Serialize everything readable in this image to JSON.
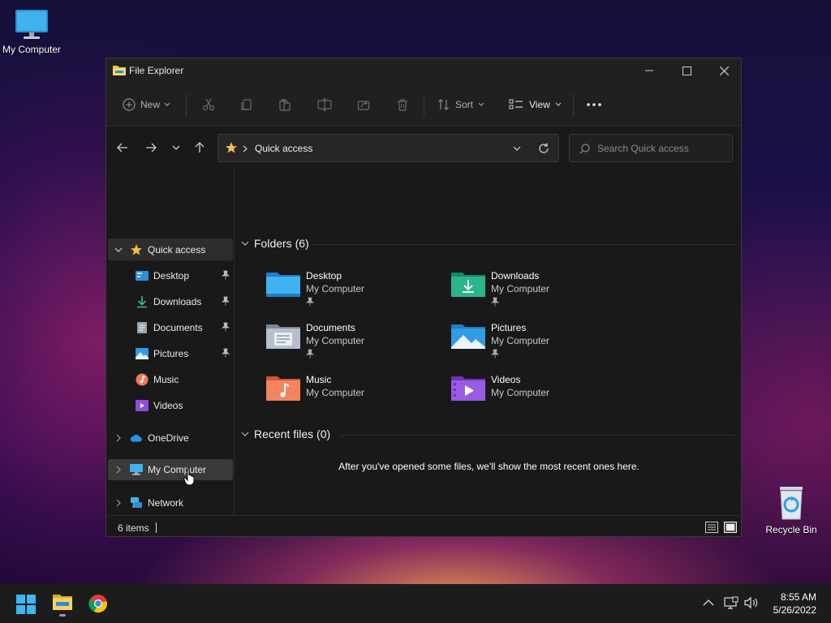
{
  "desktop": {
    "my_computer_label": "My Computer",
    "recycle_bin_label": "Recycle Bin"
  },
  "window": {
    "title": "File Explorer"
  },
  "toolbar": {
    "new_label": "New",
    "sort_label": "Sort",
    "view_label": "View"
  },
  "address": {
    "path": "Quick access",
    "search_placeholder": "Search Quick access"
  },
  "sidebar": {
    "quick_access": "Quick access",
    "pinned": [
      {
        "label": "Desktop"
      },
      {
        "label": "Downloads"
      },
      {
        "label": "Documents"
      },
      {
        "label": "Pictures"
      },
      {
        "label": "Music"
      },
      {
        "label": "Videos"
      }
    ],
    "onedrive": "OneDrive",
    "my_computer": "My Computer",
    "network": "Network"
  },
  "content": {
    "folders_header": "Folders (6)",
    "folders": [
      {
        "name": "Desktop",
        "location": "My Computer",
        "pinned": true
      },
      {
        "name": "Downloads",
        "location": "My Computer",
        "pinned": true
      },
      {
        "name": "Documents",
        "location": "My Computer",
        "pinned": true
      },
      {
        "name": "Pictures",
        "location": "My Computer",
        "pinned": true
      },
      {
        "name": "Music",
        "location": "My Computer",
        "pinned": false
      },
      {
        "name": "Videos",
        "location": "My Computer",
        "pinned": false
      }
    ],
    "recent_header": "Recent files (0)",
    "recent_empty": "After you've opened some files, we'll show the most recent ones here."
  },
  "status": {
    "item_count": "6 items"
  },
  "taskbar": {
    "time": "8:55 AM",
    "date": "5/26/2022"
  },
  "colors": {
    "accent_blue": "#4cc2ff",
    "folder_yellow": "#f4c13d",
    "selected_bg": "#2d2d2d"
  }
}
